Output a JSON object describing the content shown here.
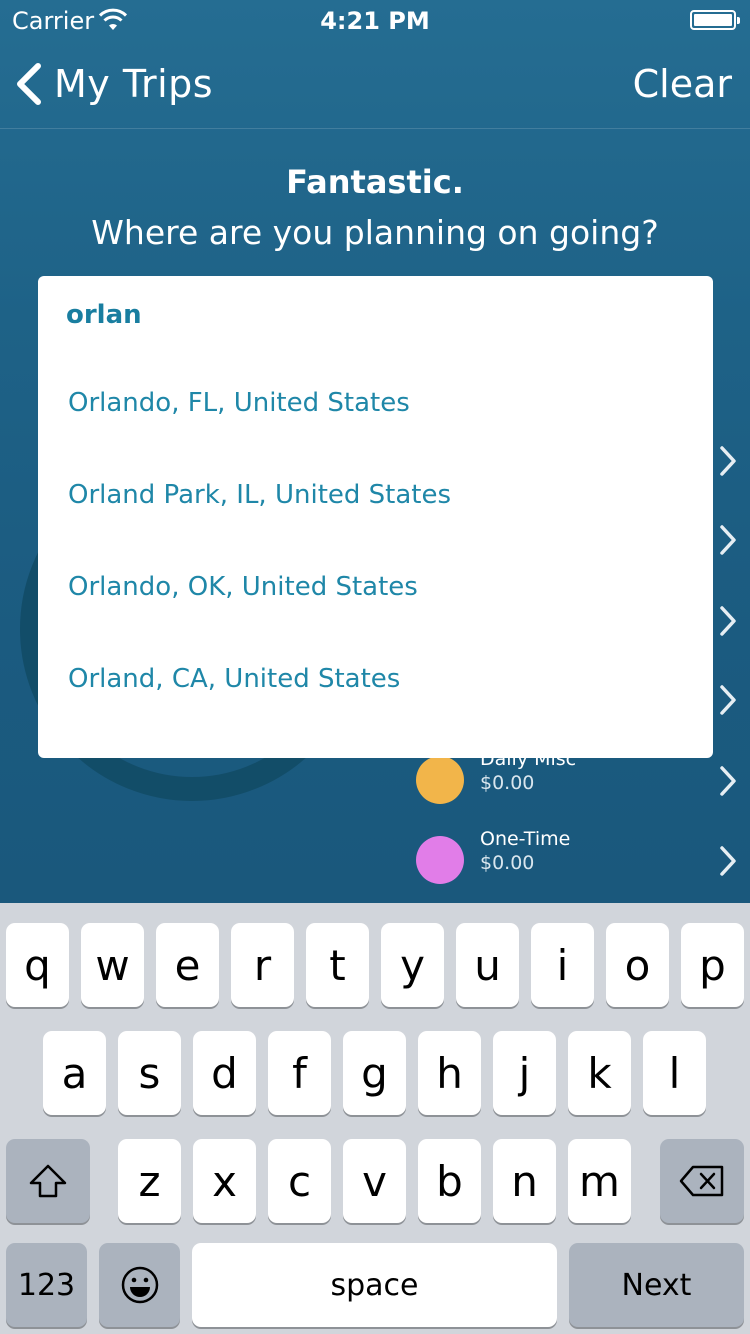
{
  "status_bar": {
    "carrier": "Carrier",
    "time": "4:21 PM"
  },
  "nav": {
    "back_label": "My Trips",
    "right_action": "Clear"
  },
  "prompt": {
    "title": "Fantastic.",
    "subtitle": "Where are you planning on going?"
  },
  "search": {
    "query": "orlan",
    "results": [
      "Orlando, FL, United States",
      "Orland Park, IL, United States",
      "Orlando, OK, United States",
      "Orland, CA, United States"
    ]
  },
  "categories": [
    {
      "name": "Daily Misc",
      "amount": "$0.00",
      "color": "#f2b54a"
    },
    {
      "name": "One-Time",
      "amount": "$0.00",
      "color": "#e17de8"
    }
  ],
  "keyboard": {
    "row1": [
      "q",
      "w",
      "e",
      "r",
      "t",
      "y",
      "u",
      "i",
      "o",
      "p"
    ],
    "row2": [
      "a",
      "s",
      "d",
      "f",
      "g",
      "h",
      "j",
      "k",
      "l"
    ],
    "row3": [
      "z",
      "x",
      "c",
      "v",
      "b",
      "n",
      "m"
    ],
    "numbers_key": "123",
    "space_key": "space",
    "return_key": "Next"
  }
}
